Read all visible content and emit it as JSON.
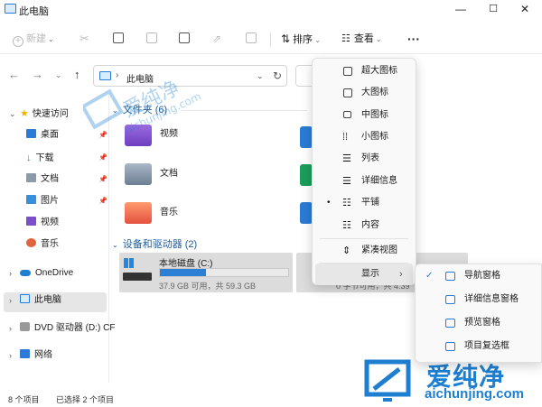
{
  "window": {
    "title": "此电脑"
  },
  "titlebar": {
    "min": "—",
    "max": "☐",
    "close": "✕"
  },
  "toolbar": {
    "new": "新建",
    "sort": "排序",
    "view": "查看",
    "more": "···"
  },
  "address": {
    "path": "此电脑",
    "sep": "›"
  },
  "sidebar": {
    "quick_access": "快速访问",
    "items": [
      "桌面",
      "下载",
      "文档",
      "图片",
      "视频",
      "音乐"
    ],
    "onedrive": "OneDrive",
    "this_pc": "此电脑",
    "dvd": "DVD 驱动器 (D:) CF",
    "network": "网络"
  },
  "main": {
    "folders_header": "文件夹 (6)",
    "folders": [
      "视频",
      "文档",
      "音乐"
    ],
    "devices_header": "设备和驱动器 (2)",
    "drive": {
      "name": "本地磁盘 (C:)",
      "free": "37.9 GB 可用，共 59.3 GB",
      "used_fraction": 0.36
    },
    "drive2_partial": "0 字节可用，共 4.39"
  },
  "status": {
    "count": "8 个项目",
    "selected": "已选择 2 个项目"
  },
  "view_menu": {
    "items": [
      "超大图标",
      "大图标",
      "中图标",
      "小图标",
      "列表",
      "详细信息",
      "平铺",
      "内容",
      "紧凑视图"
    ],
    "selected": "平铺",
    "show": "显示"
  },
  "show_submenu": {
    "items": [
      "导航窗格",
      "详细信息窗格",
      "预览窗格",
      "项目复选框"
    ],
    "checked": "导航窗格"
  },
  "watermark": {
    "brand": "爱纯净",
    "url": "aichunjing.com"
  },
  "colors": {
    "accent": "#2b7bd6",
    "progress": "#2d7fd6",
    "group_header": "#1e5c9a"
  }
}
